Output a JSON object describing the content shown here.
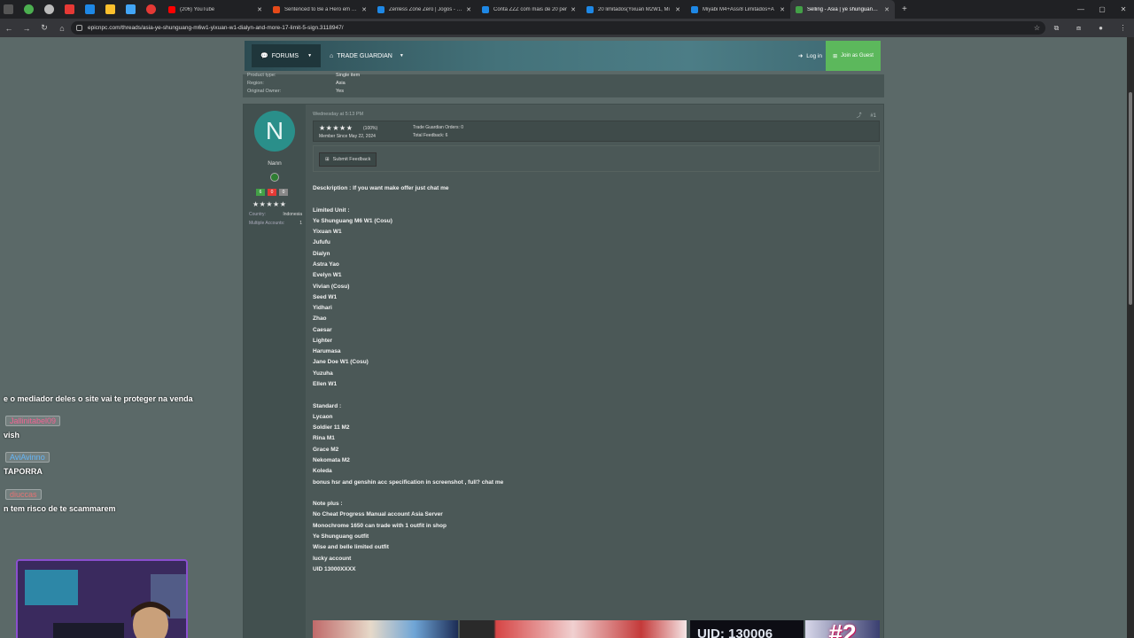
{
  "browser": {
    "tabs": [
      {
        "label": "(206) YouTube",
        "color": "#ff0000"
      },
      {
        "label": "Sentenced to Be a Hero em pre",
        "color": "#e64a19"
      },
      {
        "label": "Zenless Zone Zero | Jogos - GG",
        "color": "#1e88e5"
      },
      {
        "label": "Conta ZZZ com mais de 20 per",
        "color": "#1e88e5"
      },
      {
        "label": "20 limitados(Yixuan M2W1, Mi",
        "color": "#1e88e5"
      },
      {
        "label": "Miyabi M4+Ass/8 Limitados+A",
        "color": "#1e88e5"
      },
      {
        "label": "Selling - Asia | ye shunguang m",
        "color": "#43a047"
      }
    ],
    "url": "epicnpc.com/threads/asia-ye-shunguang-m6w1-yixuan-w1-dialyn-and-more-17-limit-5-sign.3118947/"
  },
  "navbar": {
    "forums": "FORUMS",
    "trade_guardian": "TRADE GUARDIAN",
    "login": "Log in",
    "join": "Join as Guest"
  },
  "meta": {
    "rows": [
      {
        "label": "Product type:",
        "value": "Single item"
      },
      {
        "label": "Region:",
        "value": "Asia"
      },
      {
        "label": "Original Owner:",
        "value": "Yes"
      }
    ]
  },
  "user": {
    "initial": "N",
    "name": "Nann",
    "fb_positive": "6",
    "fb_neutral": "0",
    "fb_negative": "0",
    "stars": "★★★★★",
    "country_label": "Country:",
    "country": "Indonesia",
    "accounts_label": "Multiple Accounts:",
    "accounts": "1"
  },
  "post": {
    "date": "Wednesday at 5:13 PM",
    "number": "#1",
    "tg_stars": "★★★★★",
    "tg_percent": "(100%)",
    "member_since": "Member Since May 22, 2024",
    "tg_orders": "Trade Guardian Orders: 0",
    "tg_feedback": "Total Feedback: 6",
    "submit_feedback": "Submit Feedback",
    "lines": [
      "Desckription : If you want make offer just chat me",
      "",
      "Limited Unit :",
      "Ye Shunguang M6 W1 (Cosu)",
      "Yixuan W1",
      "Jufufu",
      "Dialyn",
      "Astra Yao",
      "Evelyn W1",
      "Vivian (Cosu)",
      "Seed W1",
      "Yidhari",
      "Zhao",
      "Caesar",
      "Lighter",
      "Harumasa",
      "Jane Doe W1 (Cosu)",
      "Yuzuha",
      "Ellen W1",
      "",
      "Standard :",
      "Lycaon",
      "Soldier 11 M2",
      "Rina M1",
      "Grace M2",
      "Nekomata M2",
      "Koleda",
      "bonus hsr and genshin acc specification in screenshot , full? chat me",
      "",
      "Note plus :",
      "No Cheat Progress Manual account Asia Server",
      "Monochrome 1650 can trade with 1 outfit in shop",
      "Ye Shunguang outfit",
      "Wise and belle limited outfit",
      "lucky account",
      "UID 13000XXXX"
    ]
  },
  "screenshots": {
    "uid_text": "UID: 130006",
    "badge": "#2"
  },
  "chat": {
    "lines": [
      {
        "type": "text",
        "text": "e o mediador deles o site vai te proteger na venda"
      },
      {
        "type": "name",
        "text": "Jallinitabel09",
        "color": "#f06292"
      },
      {
        "type": "text",
        "text": "vish"
      },
      {
        "type": "name",
        "text": "AviAvinno",
        "color": "#64b5f6"
      },
      {
        "type": "text",
        "text": "TAPORRA"
      },
      {
        "type": "name",
        "text": "diuccas",
        "color": "#e57373"
      },
      {
        "type": "text",
        "text": "n tem risco de te scammarem"
      }
    ]
  },
  "colors": {
    "accent_green": "#5cb85c",
    "avatar_teal": "#2a8f8a",
    "page_bg": "#5b6968"
  }
}
